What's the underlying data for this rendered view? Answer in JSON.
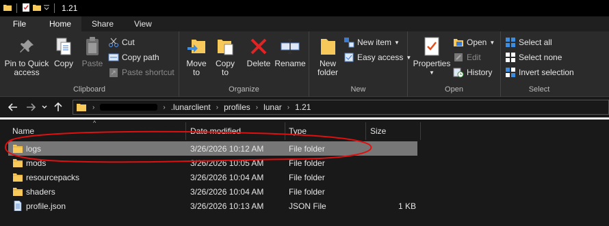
{
  "window": {
    "title": "1.21"
  },
  "ribbon_tabs": [
    "File",
    "Home",
    "Share",
    "View"
  ],
  "clipboard": {
    "pin_line1": "Pin to Quick",
    "pin_line2": "access",
    "copy": "Copy",
    "paste": "Paste",
    "cut": "Cut",
    "copy_path": "Copy path",
    "paste_shortcut": "Paste shortcut",
    "label": "Clipboard"
  },
  "organize": {
    "move_line1": "Move",
    "move_line2": "to",
    "copy_line1": "Copy",
    "copy_line2": "to",
    "delete": "Delete",
    "rename": "Rename",
    "label": "Organize"
  },
  "new_group": {
    "new_folder_line1": "New",
    "new_folder_line2": "folder",
    "new_item": "New item",
    "easy_access": "Easy access",
    "label": "New"
  },
  "open_group": {
    "properties": "Properties",
    "open": "Open",
    "edit": "Edit",
    "history": "History",
    "label": "Open"
  },
  "select_group": {
    "select_all": "Select all",
    "select_none": "Select none",
    "invert": "Invert selection",
    "label": "Select"
  },
  "address": {
    "crumbs": [
      ".lunarclient",
      "profiles",
      "lunar",
      "1.21"
    ]
  },
  "columns": {
    "name": "Name",
    "date": "Date modified",
    "type": "Type",
    "size": "Size"
  },
  "files": [
    {
      "name": "logs",
      "date": "3/26/2026 10:12 AM",
      "type": "File folder",
      "size": "",
      "icon": "folder-icon",
      "selected": true
    },
    {
      "name": "mods",
      "date": "3/26/2026 10:05 AM",
      "type": "File folder",
      "size": "",
      "icon": "folder-icon"
    },
    {
      "name": "resourcepacks",
      "date": "3/26/2026 10:04 AM",
      "type": "File folder",
      "size": "",
      "icon": "folder-icon"
    },
    {
      "name": "shaders",
      "date": "3/26/2026 10:04 AM",
      "type": "File folder",
      "size": "",
      "icon": "folder-icon"
    },
    {
      "name": "profile.json",
      "date": "3/26/2026 10:13 AM",
      "type": "JSON File",
      "size": "1 KB",
      "icon": "json-file-icon"
    }
  ],
  "colors": {
    "selection": "#777777",
    "folder": "#f6c95a",
    "annotation": "#e01010"
  }
}
